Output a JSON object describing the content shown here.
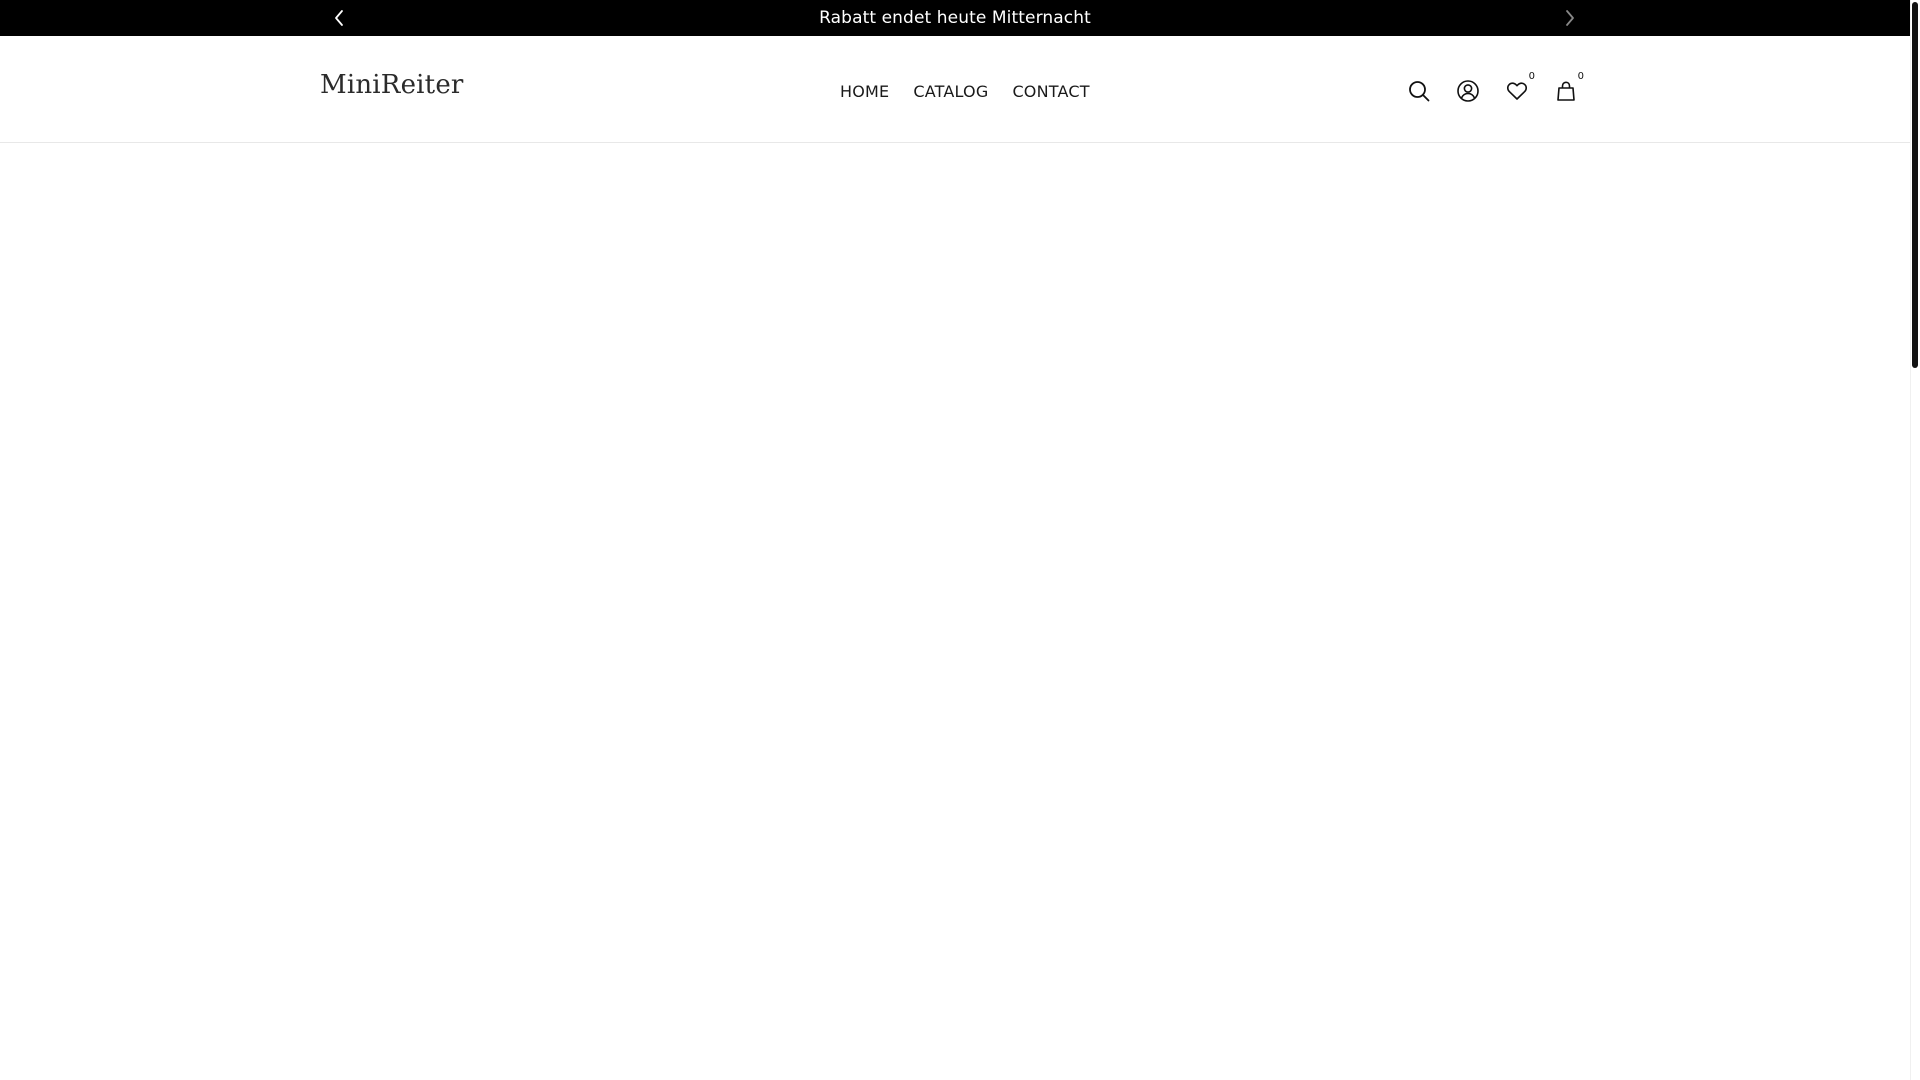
{
  "announcement": {
    "text": "Rabatt endet heute Mitternacht",
    "prev_icon": "chevron-left-icon",
    "next_icon": "chevron-right-icon"
  },
  "header": {
    "logo": "MiniReiter",
    "nav": [
      {
        "label": "HOME"
      },
      {
        "label": "CATALOG"
      },
      {
        "label": "CONTACT"
      }
    ],
    "icons": {
      "search": "search-icon",
      "account": "user-circle-icon",
      "wishlist": "heart-icon",
      "cart": "shopping-bag-icon"
    },
    "wishlist_count": "0",
    "cart_count": "0"
  },
  "colors": {
    "announcement_bg": "#000000",
    "announcement_text": "#ffffff",
    "text_primary": "#1a1a1a",
    "background": "#ffffff",
    "next_arrow": "#888888"
  }
}
